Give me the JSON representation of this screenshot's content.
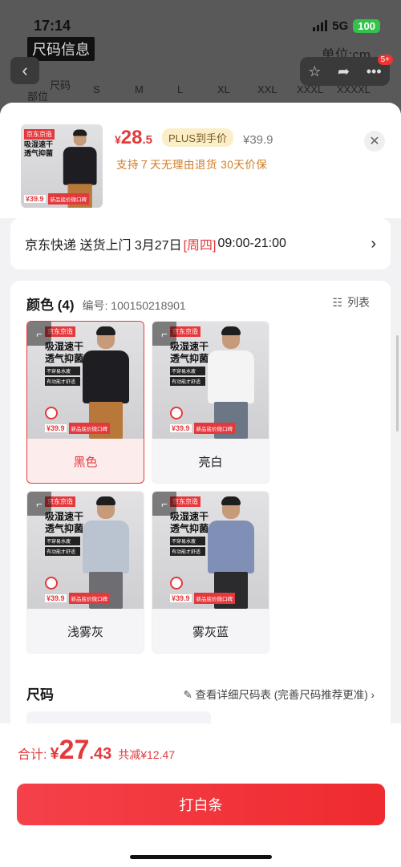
{
  "status": {
    "time": "17:14",
    "network": "5G",
    "battery": "100"
  },
  "background": {
    "title": "尺码信息",
    "unit": "单位:cm",
    "badge": "5+",
    "size_header": {
      "label1": "尺码",
      "label2": "部位",
      "sizes": [
        "S",
        "M",
        "L",
        "XL",
        "XXL",
        "XXXL",
        "XXXXL"
      ]
    }
  },
  "product": {
    "price_yen": "¥",
    "price_int": "28",
    "price_dec": ".5",
    "plus_tag": "PLUS到手价",
    "original_price": "¥39.9",
    "policy": "支持７天无理由退货   30天价保"
  },
  "delivery": {
    "prefix": "京东快递 送货上门 3月27日 ",
    "weekday": "[周四]",
    "time": " 09:00-21:00"
  },
  "options": {
    "title": "颜色 (4)",
    "code": "编号: 100150218901",
    "list_label": "列表",
    "image_text": {
      "brand": "京东京造",
      "slogan1": "吸湿速干",
      "slogan2": "透气抑菌",
      "chip1": "不穿易水疲",
      "chip2": "有动能才舒适",
      "promo_price": "¥39.9",
      "promo_tag": "新品底价微口碑"
    },
    "colors": [
      {
        "label": "黑色",
        "selected": true,
        "shirt": "#1d1d22",
        "pants": "#b8783a"
      },
      {
        "label": "亮白",
        "selected": false,
        "shirt": "#f4f4f4",
        "pants": "#6b7785"
      },
      {
        "label": "浅雾灰",
        "selected": false,
        "shirt": "#b9c4d0",
        "pants": "#6d6d72"
      },
      {
        "label": "雾灰蓝",
        "selected": false,
        "shirt": "#7f8fb5",
        "pants": "#2b2b2e"
      }
    ]
  },
  "size": {
    "title": "尺码",
    "link": "查看详细尺码表 (完善尺码推荐更准)"
  },
  "bottom": {
    "total_label": "合计:",
    "total_yen": "¥",
    "total_int": "27",
    "total_dec": ".43",
    "saving": "共减¥12.47",
    "pay_button": "打白条"
  }
}
